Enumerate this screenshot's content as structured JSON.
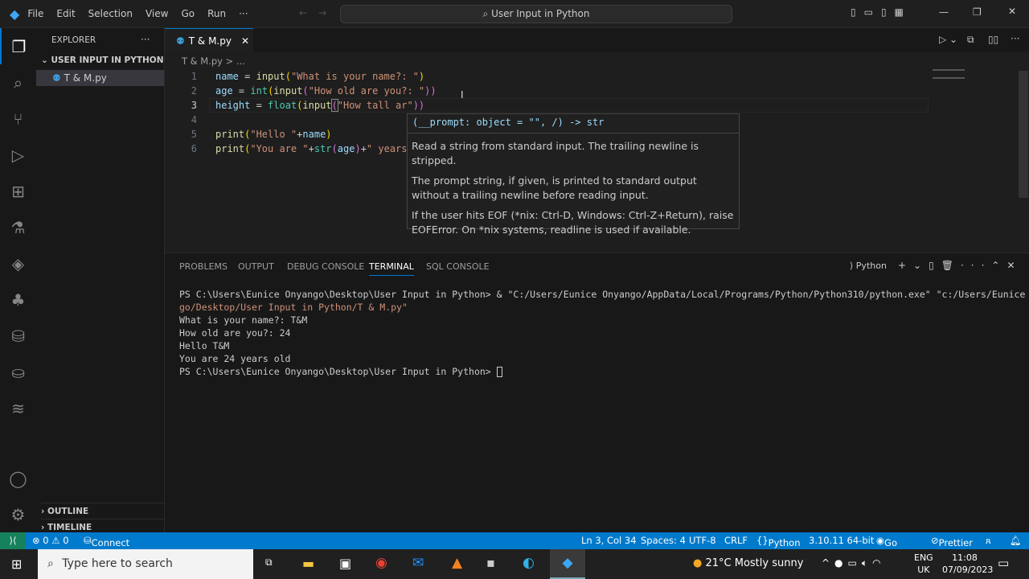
{
  "titlebar": {
    "menu": [
      "File",
      "Edit",
      "Selection",
      "View",
      "Go",
      "Run",
      "···"
    ],
    "search": "User Input in Python"
  },
  "sidebar": {
    "title": "EXPLORER",
    "more": "···",
    "folder": "USER INPUT IN PYTHON",
    "file": "T & M.py",
    "outline": "OUTLINE",
    "timeline": "TIMELINE"
  },
  "editor": {
    "tab": "T & M.py",
    "breadcrumb": "T & M.py > ...",
    "line_numbers": [
      "1",
      "2",
      "3",
      "4",
      "5",
      "6"
    ],
    "hover": {
      "signature": "(__prompt: object = \"\", /) -> str",
      "p1": "Read a string from standard input. The trailing newline is stripped.",
      "p2": "The prompt string, if given, is printed to standard output without a trailing newline before reading input.",
      "p3": "If the user hits EOF (*nix: Ctrl-D, Windows: Ctrl-Z+Return), raise EOFError. On *nix systems, readline is used if available."
    }
  },
  "code": {
    "l1": [
      "name",
      " = ",
      "input",
      "(",
      "\"What is your name?: \"",
      ")"
    ],
    "l2": [
      "age",
      " = ",
      "int",
      "(",
      "input",
      "(",
      "\"How old are you?: \"",
      "))"
    ],
    "l3": [
      "height",
      " = ",
      "float",
      "(",
      "input",
      "(",
      "\"How tall ar\"",
      "))"
    ],
    "l5": [
      "print",
      "(",
      "\"Hello \"",
      "+",
      "name",
      ")"
    ],
    "l6": [
      "print",
      "(",
      "\"You are \"",
      "+",
      "str",
      "(",
      "age",
      ")",
      "+",
      "\" years"
    ]
  },
  "panel": {
    "tabs": [
      "PROBLEMS",
      "OUTPUT",
      "DEBUG CONSOLE",
      "TERMINAL",
      "SQL CONSOLE"
    ],
    "shell": "Python",
    "terminal": [
      "PS C:\\Users\\Eunice Onyango\\Desktop\\User Input in Python> & \"C:/Users/Eunice Onyango/AppData/Local/Programs/Python/Python310/python.exe\" \"c:/Users/Eunice Onyan",
      "go/Desktop/User Input in Python/T & M.py\"",
      "What is your name?: T&M",
      "How old are you?: 24",
      "Hello T&M",
      "You are 24 years old",
      "PS C:\\Users\\Eunice Onyango\\Desktop\\User Input in Python> "
    ]
  },
  "status": {
    "errors": "⊗ 0 ⚠ 0",
    "connect": "Connect",
    "position": "Ln 3, Col 34",
    "spaces": "Spaces: 4",
    "encoding": "UTF-8",
    "eol": "CRLF",
    "language": "Python",
    "interpreter": "3.10.11 64-bit",
    "golive": "Go Live",
    "prettier": "Prettier"
  },
  "taskbar": {
    "search": "Type here to search",
    "weather": "21°C  Mostly sunny",
    "lang1": "ENG",
    "lang2": "UK",
    "time": "11:08",
    "date": "07/09/2023"
  },
  "colors": {
    "accent": "#007acc",
    "remote": "#16825d"
  }
}
